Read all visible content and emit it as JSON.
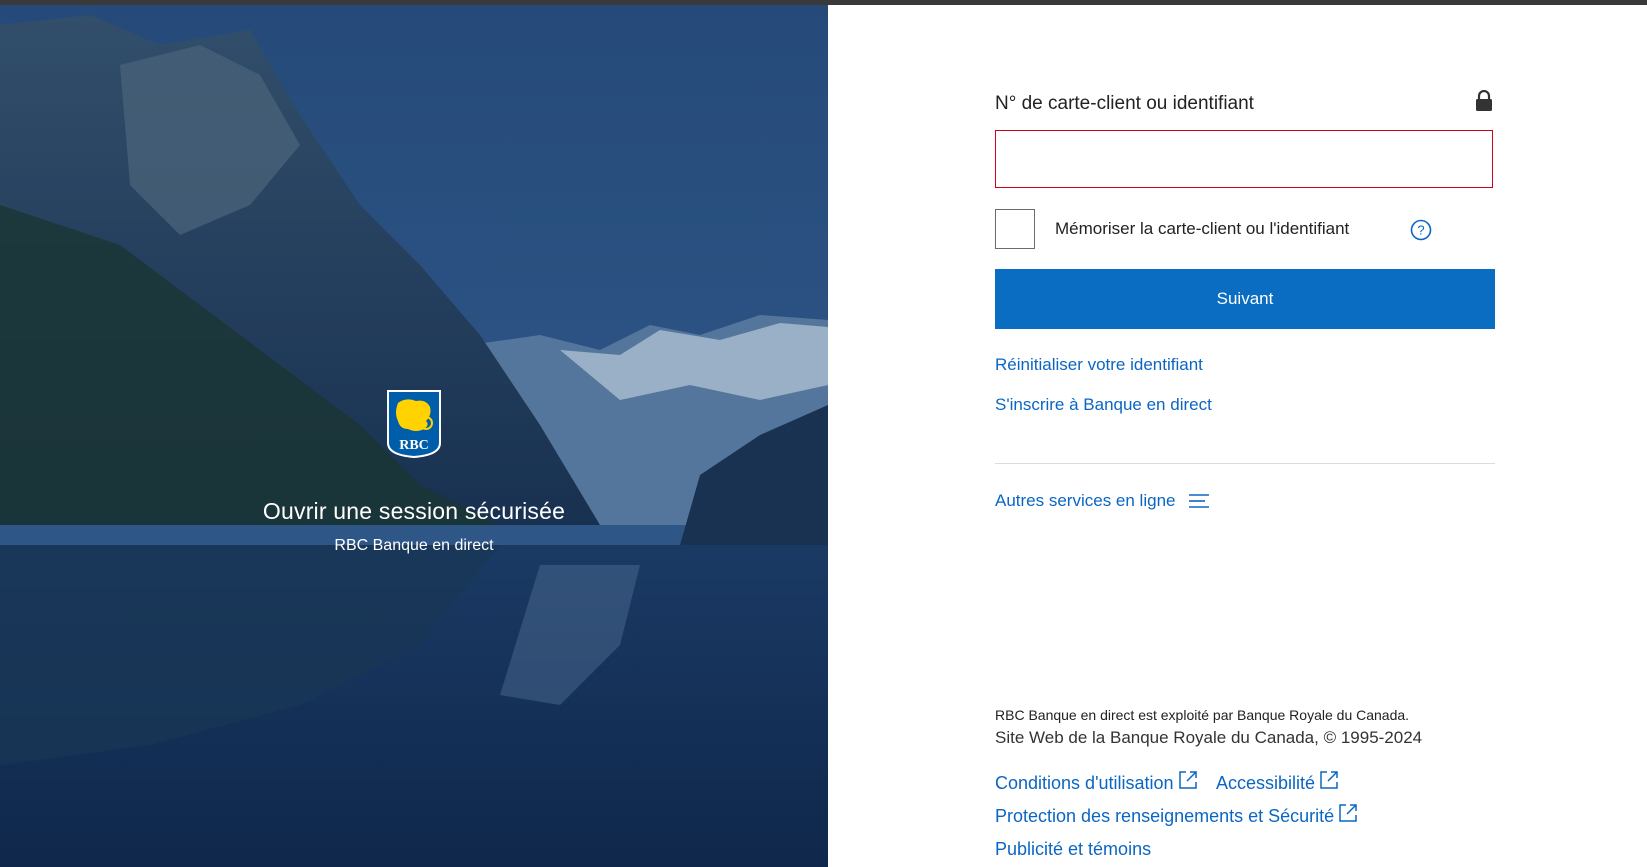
{
  "hero": {
    "title": "Ouvrir une session sécurisée",
    "subtitle": "RBC Banque en direct",
    "logo_text": "RBC"
  },
  "form": {
    "field_label": "N° de carte-client ou identifiant",
    "input_value": "",
    "remember_label": "Mémoriser la carte-client ou l'identifiant",
    "next_button": "Suivant"
  },
  "links": {
    "reset_id": "Réinitialiser votre identifiant",
    "enroll": "S'inscrire à Banque en direct",
    "other_services": "Autres services en ligne"
  },
  "footer": {
    "line1": "RBC Banque en direct est exploité par Banque Royale du Canada.",
    "line2": "Site Web de la Banque Royale du Canada, © 1995-2024",
    "terms": "Conditions d'utilisation",
    "accessibility": "Accessibilité",
    "privacy": "Protection des renseignements et Sécurité",
    "ads": "Publicité et témoins"
  },
  "colors": {
    "primary": "#0a6dc2",
    "link": "#0b66c3",
    "error_border": "#d0021b",
    "logo_blue": "#005daa",
    "logo_gold": "#ffd200"
  },
  "icons": [
    "lock-icon",
    "help-icon",
    "menu-lines-icon",
    "external-link-icon",
    "rbc-logo"
  ]
}
